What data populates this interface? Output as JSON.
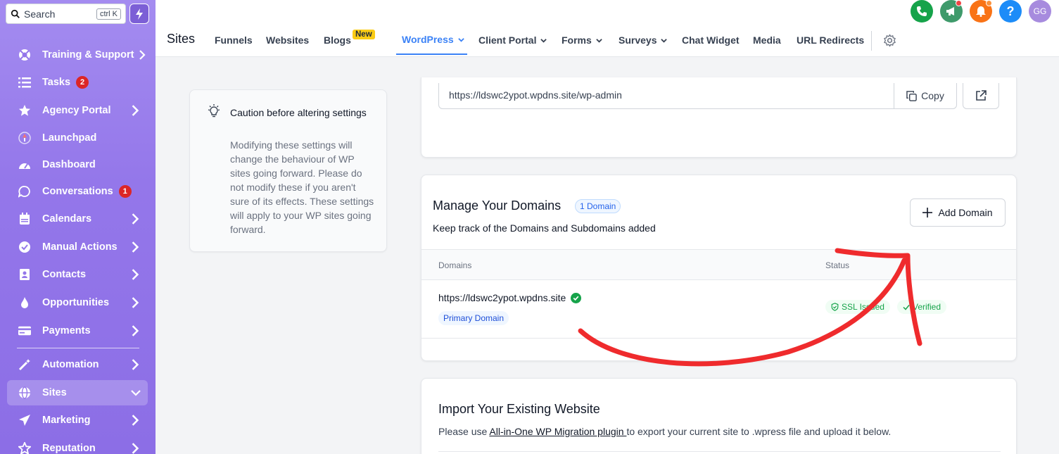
{
  "search": {
    "placeholder": "Search",
    "shortcut": "ctrl K"
  },
  "sidebar": {
    "items": [
      {
        "label": "Training & Support",
        "icon": "lifebuoy-icon",
        "chevron": true
      },
      {
        "label": "Tasks",
        "icon": "checklist-icon",
        "badge": "2"
      },
      {
        "label": "Agency Portal",
        "icon": "star-icon",
        "chevron": true
      },
      {
        "label": "Launchpad",
        "icon": "rocket-icon"
      },
      {
        "label": "Dashboard",
        "icon": "gauge-icon"
      },
      {
        "label": "Conversations",
        "icon": "chat-icon",
        "badge": "1"
      },
      {
        "label": "Calendars",
        "icon": "calendar-icon",
        "chevron": true
      },
      {
        "label": "Manual Actions",
        "icon": "check-circle-icon",
        "chevron": true
      },
      {
        "label": "Contacts",
        "icon": "contact-book-icon",
        "chevron": true
      },
      {
        "label": "Opportunities",
        "icon": "flame-icon",
        "chevron": true
      },
      {
        "label": "Payments",
        "icon": "credit-card-icon",
        "chevron": true
      },
      {
        "label": "Automation",
        "icon": "magic-wand-icon",
        "chevron": true
      },
      {
        "label": "Sites",
        "icon": "globe-icon",
        "active": true
      },
      {
        "label": "Marketing",
        "icon": "paper-plane-icon",
        "chevron": true
      },
      {
        "label": "Reputation",
        "icon": "star-outline-icon",
        "chevron": true
      }
    ]
  },
  "header": {
    "title": "Sites",
    "tabs": [
      {
        "label": "Funnels"
      },
      {
        "label": "Websites"
      },
      {
        "label": "Blogs",
        "badge": "New"
      },
      {
        "label": "WordPress",
        "active": true,
        "dropdown": true
      },
      {
        "label": "Client Portal",
        "dropdown": true
      },
      {
        "label": "Forms",
        "dropdown": true
      },
      {
        "label": "Surveys",
        "dropdown": true
      },
      {
        "label": "Chat Widget"
      },
      {
        "label": "Media"
      },
      {
        "label": "URL Redirects"
      }
    ],
    "avatar_initials": "GG"
  },
  "caution": {
    "title": "Caution before altering settings",
    "body": "Modifying these settings will change the behaviour of WP sites going forward. Please do not modify these if you aren't sure of its effects. These settings will apply to your WP sites going forward."
  },
  "admin": {
    "url": "https://ldswc2ypot.wpdns.site/wp-admin",
    "copy_label": "Copy"
  },
  "domains": {
    "title": "Manage Your Domains",
    "count": "1 Domain",
    "subtitle": "Keep track of the Domains and Subdomains added",
    "add_label": "Add Domain",
    "col_domains": "Domains",
    "col_status": "Status",
    "rows": [
      {
        "url": "https://ldswc2ypot.wpdns.site",
        "primary": "Primary Domain",
        "ssl": "SSL Issued",
        "verified": "Verified"
      }
    ]
  },
  "import": {
    "title": "Import Your Existing Website",
    "text_before": "Please use ",
    "link": "All-in-One WP Migration plugin ",
    "text_after": "to export your current site to .wpress file and upload it below."
  },
  "colors": {
    "sidebar": "#9477ea",
    "accent": "#3b82f6",
    "arrow": "#ef2b2d",
    "badge_red": "#dc2626"
  }
}
